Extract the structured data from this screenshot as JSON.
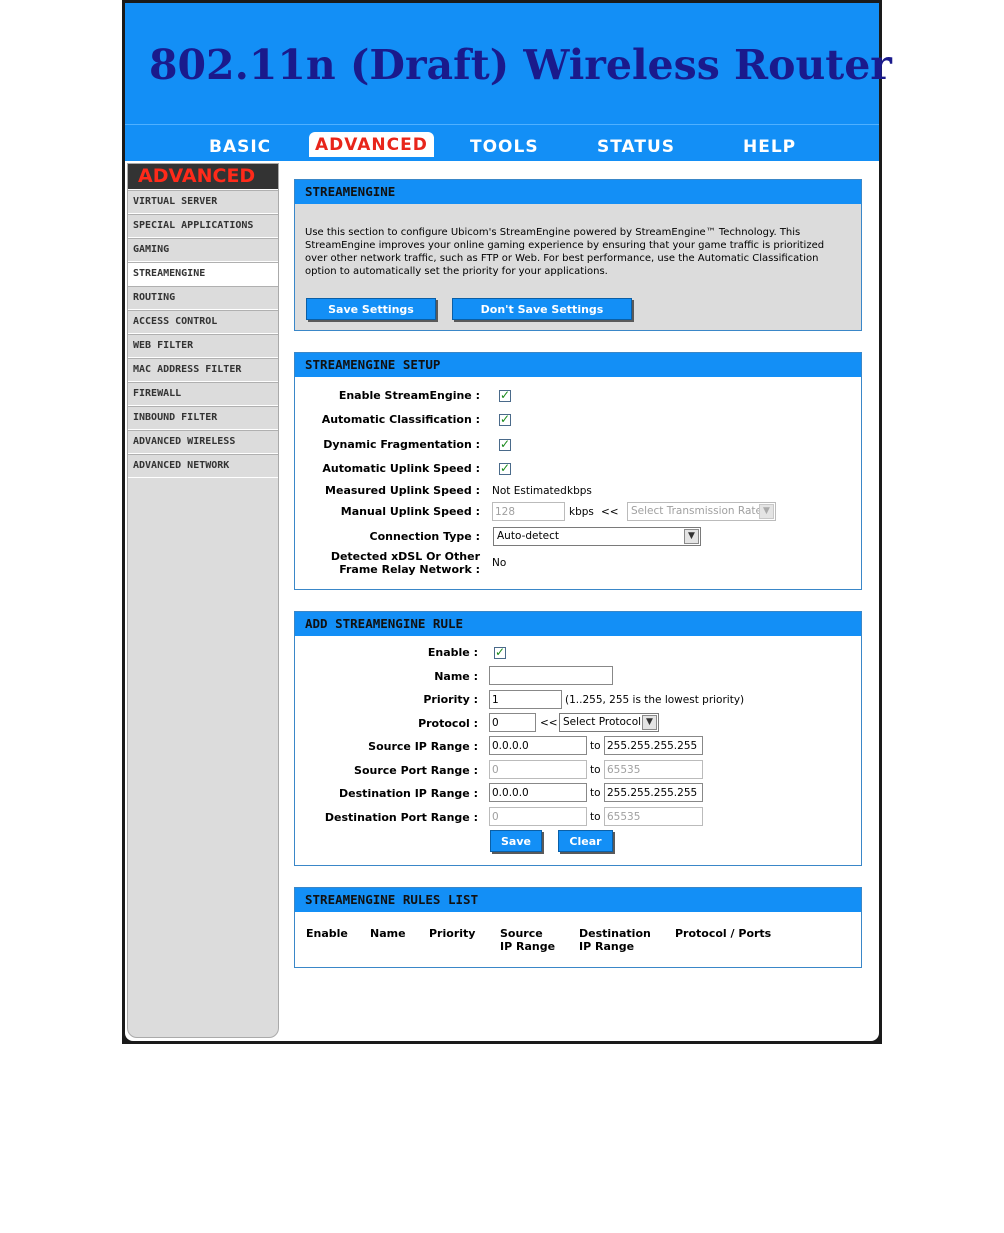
{
  "banner": {
    "title": "802.11n (Draft) Wireless Router"
  },
  "nav": {
    "basic": "BASIC",
    "advanced": "ADVANCED",
    "tools": "TOOLS",
    "status": "STATUS",
    "help": "HELP"
  },
  "sidebar": {
    "heading": "ADVANCED",
    "items": [
      "VIRTUAL SERVER",
      "SPECIAL APPLICATIONS",
      "GAMING",
      "STREAMENGINE",
      "ROUTING",
      "ACCESS CONTROL",
      "WEB FILTER",
      "MAC ADDRESS FILTER",
      "FIREWALL",
      "INBOUND FILTER",
      "ADVANCED WIRELESS",
      "ADVANCED NETWORK"
    ],
    "active_item": "STREAMENGINE"
  },
  "intro": {
    "heading": "STREAMENGINE",
    "text": "Use this section to configure Ubicom's StreamEngine powered by StreamEngine™ Technology. This StreamEngine improves your online gaming experience by ensuring that your game traffic is prioritized over other network traffic, such as FTP or Web. For best performance, use the Automatic Classification option to automatically set the priority for your applications.",
    "save_label": "Save Settings",
    "dont_save_label": "Don't Save Settings"
  },
  "setup": {
    "heading": "STREAMENGINE SETUP",
    "enable_label": "Enable StreamEngine :",
    "auto_class_label": "Automatic Classification :",
    "dyn_frag_label": "Dynamic Fragmentation :",
    "auto_uplink_label": "Automatic Uplink Speed :",
    "measured_label": "Measured Uplink Speed :",
    "measured_value": "Not Estimated",
    "measured_unit": "kbps",
    "manual_label": "Manual Uplink Speed :",
    "manual_value": "128",
    "manual_unit": "kbps",
    "manual_arrow": "<<",
    "rate_select": "Select Transmission Rate",
    "conn_type_label": "Connection Type :",
    "conn_type_value": "Auto-detect",
    "xdsl_label_1": "Detected xDSL Or Other",
    "xdsl_label_2": "Frame Relay Network :",
    "xdsl_value": "No"
  },
  "rule": {
    "heading": "ADD STREAMENGINE RULE",
    "enable_label": "Enable :",
    "name_label": "Name :",
    "name_value": "",
    "priority_label": "Priority :",
    "priority_value": "1",
    "priority_hint": "(1..255, 255 is the lowest priority)",
    "protocol_label": "Protocol :",
    "protocol_value": "0",
    "protocol_arrow": "<<",
    "protocol_select": "Select Protocol",
    "src_ip_label": "Source IP Range :",
    "src_ip_from": "0.0.0.0",
    "src_ip_to": "255.255.255.255",
    "src_port_label": "Source Port Range :",
    "src_port_from": "0",
    "src_port_to": "65535",
    "dst_ip_label": "Destination IP Range :",
    "dst_ip_from": "0.0.0.0",
    "dst_ip_to": "255.255.255.255",
    "dst_port_label": "Destination Port Range :",
    "dst_port_from": "0",
    "dst_port_to": "65535",
    "to_label": "to",
    "save_label": "Save",
    "clear_label": "Clear"
  },
  "rules_list": {
    "heading": "STREAMENGINE RULES LIST",
    "col_enable": "Enable",
    "col_name": "Name",
    "col_priority": "Priority",
    "col_source_1": "Source",
    "col_source_2": "IP Range",
    "col_dest_1": "Destination",
    "col_dest_2": "IP Range",
    "col_protocol": "Protocol / Ports"
  },
  "colors": {
    "brand_blue": "#138ff6",
    "nav_active_text": "#e8251a",
    "title_navy": "#1a1a8c"
  }
}
